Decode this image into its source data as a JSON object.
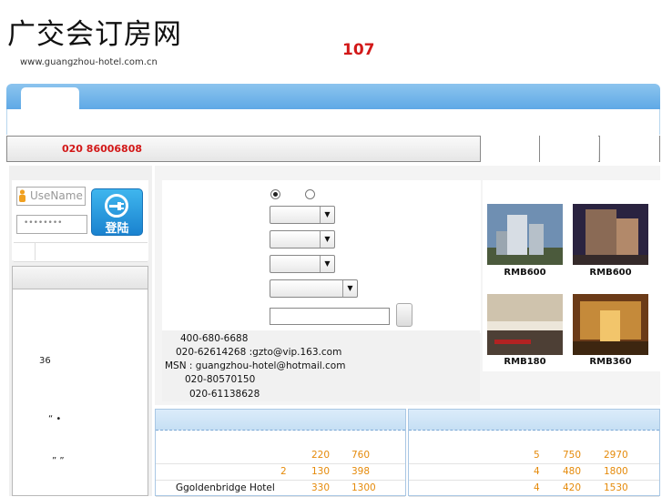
{
  "header": {
    "logo_title": "广交会订房网",
    "logo_url": "www.guangzhou-hotel.com.cn",
    "count": "107"
  },
  "phone_bar": {
    "phone": "020  86006808"
  },
  "login": {
    "username_placeholder": "UseName",
    "password_mask": "••••••••",
    "login_button": "登陆"
  },
  "left_panel": {
    "number": "36",
    "quote_a": "“  •",
    "quote_b": "”  ”"
  },
  "contact": {
    "line1": "400-680-6688",
    "line2": "020-62614268     :gzto@vip.163.com",
    "line3": "MSN : guangzhou-hotel@hotmail.com",
    "line4": "020-80570150",
    "line5": "020-61138628"
  },
  "featured_hotels": [
    {
      "price": "RMB600"
    },
    {
      "price": "RMB600"
    },
    {
      "price": "RMB180"
    },
    {
      "price": "RMB360"
    }
  ],
  "table_left": {
    "rows": [
      {
        "name": "",
        "c1": "",
        "c2": "220",
        "c3": "760"
      },
      {
        "name": "",
        "c1": "2",
        "c2": "130",
        "c3": "398"
      },
      {
        "name": "Ggoldenbridge Hotel",
        "c1": "",
        "c2": "330",
        "c3": "1300"
      }
    ]
  },
  "table_right": {
    "rows": [
      {
        "c1": "5",
        "c2": "750",
        "c3": "2970"
      },
      {
        "c1": "4",
        "c2": "480",
        "c3": "1800"
      },
      {
        "c1": "4",
        "c2": "420",
        "c3": "1530"
      }
    ]
  },
  "colors": {
    "accent_red": "#d21818",
    "nav_blue": "#5fa9e6",
    "price_orange": "#e58a0a"
  }
}
